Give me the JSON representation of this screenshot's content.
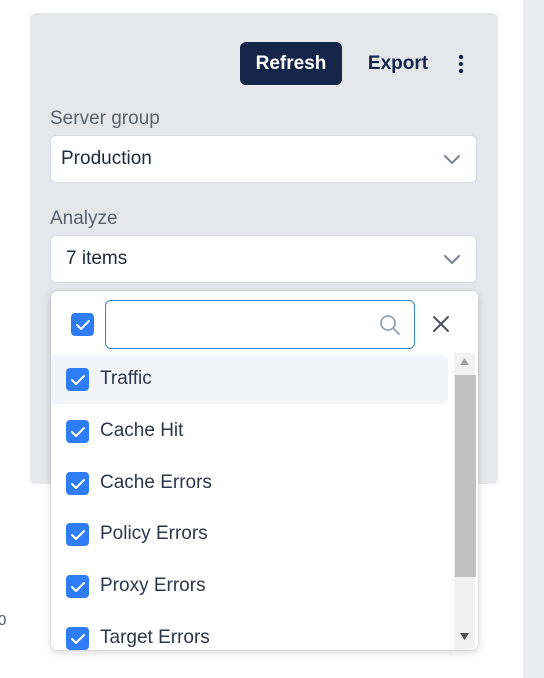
{
  "toolbar": {
    "refresh_label": "Refresh",
    "export_label": "Export",
    "more_icon": "vertical-ellipsis"
  },
  "server_group": {
    "label": "Server group",
    "value": "Production"
  },
  "analyze": {
    "label": "Analyze",
    "value": "7 items"
  },
  "dropdown": {
    "select_all_checked": true,
    "search": {
      "value": "",
      "placeholder": ""
    },
    "options": [
      {
        "label": "Traffic",
        "checked": true,
        "highlighted": true
      },
      {
        "label": "Cache Hit",
        "checked": true
      },
      {
        "label": "Cache Errors",
        "checked": true
      },
      {
        "label": "Policy Errors",
        "checked": true
      },
      {
        "label": "Proxy Errors",
        "checked": true
      },
      {
        "label": "Target Errors",
        "checked": true
      }
    ]
  },
  "background_fragment": "0",
  "colors": {
    "primary_button": "#14254a",
    "checkbox": "#2f7df6",
    "panel_bg": "#e5e7eb",
    "search_border": "#3b82c4"
  }
}
